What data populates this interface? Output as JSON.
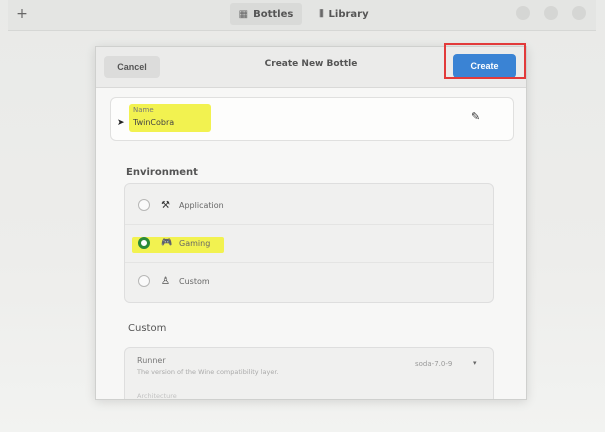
{
  "app": {
    "tabs": [
      {
        "label": "Bottles",
        "icon": "bottles-icon",
        "glyph": "▦"
      },
      {
        "label": "Library",
        "icon": "library-icon",
        "glyph": "⫴"
      }
    ],
    "add_glyph": "+"
  },
  "dialog": {
    "title": "Create New Bottle",
    "cancel_label": "Cancel",
    "create_label": "Create",
    "name": {
      "label": "Name",
      "value": "TwinCobra",
      "edit_glyph": "✎"
    },
    "environment": {
      "title": "Environment",
      "options": [
        {
          "label": "Application",
          "glyph": "⚒",
          "selected": false
        },
        {
          "label": "Gaming",
          "glyph": "🎮",
          "selected": true
        },
        {
          "label": "Custom",
          "glyph": "♙",
          "selected": false
        }
      ]
    },
    "custom": {
      "title": "Custom",
      "runner": {
        "label": "Runner",
        "description": "The version of the Wine compatibility layer.",
        "value": "soda-7.0-9",
        "caret": "▾"
      },
      "next_row_label": "Architecture"
    }
  },
  "colors": {
    "accent": "#3a83d4",
    "highlight": "#f2f250",
    "annotation_box": "#e23a3a",
    "radio_selected": "#2b8a38"
  }
}
